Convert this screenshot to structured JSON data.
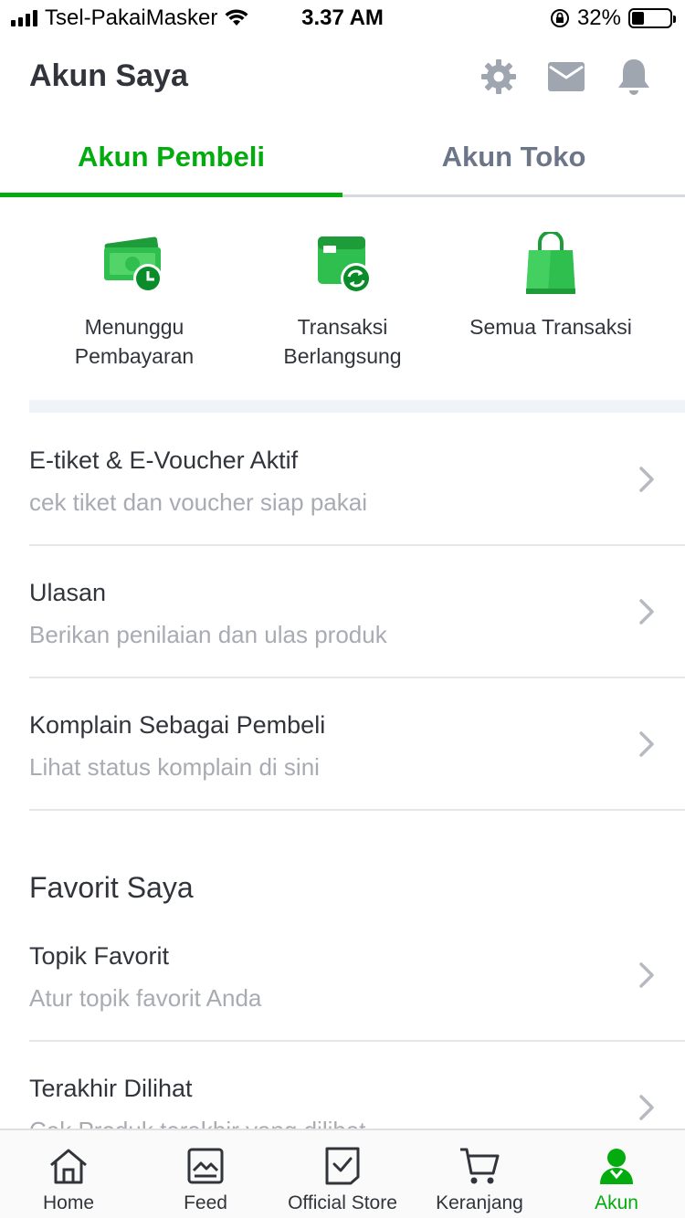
{
  "status_bar": {
    "carrier": "Tsel-PakaiMasker",
    "time": "3.37 AM",
    "battery": "32%",
    "battery_level": 0.32
  },
  "header": {
    "title": "Akun Saya",
    "icons": [
      "gear-icon",
      "mail-icon",
      "bell-icon"
    ]
  },
  "tabs": [
    {
      "label": "Akun Pembeli",
      "active": true
    },
    {
      "label": "Akun Toko",
      "active": false
    }
  ],
  "quick_actions": [
    {
      "line1": "Menunggu",
      "line2": "Pembayaran",
      "icon": "wallet-clock-icon"
    },
    {
      "line1": "Transaksi",
      "line2": "Berlangsung",
      "icon": "wallet-refresh-icon"
    },
    {
      "line1": "Semua Transaksi",
      "line2": "",
      "icon": "shopping-bag-icon"
    }
  ],
  "list": [
    {
      "title": "E-tiket & E-Voucher Aktif",
      "subtitle": "cek tiket dan voucher siap pakai"
    },
    {
      "title": "Ulasan",
      "subtitle": "Berikan penilaian dan ulas produk"
    },
    {
      "title": "Komplain Sebagai Pembeli",
      "subtitle": "Lihat status komplain di sini"
    }
  ],
  "favorites": {
    "section_title": "Favorit Saya",
    "items": [
      {
        "title": "Topik Favorit",
        "subtitle": "Atur topik favorit Anda"
      },
      {
        "title": "Terakhir Dilihat",
        "subtitle": "Cek Produk terakhir yang dilihat"
      }
    ]
  },
  "bottom_nav": [
    {
      "label": "Home",
      "icon": "home-icon",
      "active": false
    },
    {
      "label": "Feed",
      "icon": "feed-icon",
      "active": false
    },
    {
      "label": "Official Store",
      "icon": "official-store-icon",
      "active": false
    },
    {
      "label": "Keranjang",
      "icon": "cart-icon",
      "active": false
    },
    {
      "label": "Akun",
      "icon": "account-icon",
      "active": true
    }
  ],
  "colors": {
    "accent": "#03ac0e",
    "text": "#31353b",
    "muted": "#a8abb1",
    "icon_gray": "#9fa6b0"
  }
}
